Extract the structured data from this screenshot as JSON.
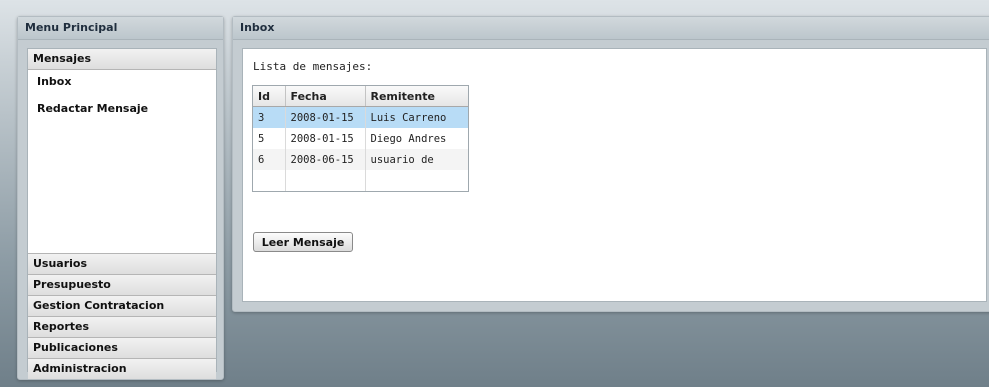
{
  "menu": {
    "title": "Menu Principal",
    "mensajes": {
      "label": "Mensajes",
      "links": [
        "Inbox",
        "Redactar Mensaje"
      ]
    },
    "sections": [
      "Usuarios",
      "Presupuesto",
      "Gestion Contratacion",
      "Reportes",
      "Publicaciones",
      "Administracion"
    ]
  },
  "inbox": {
    "title": "Inbox",
    "caption": "Lista de mensajes:",
    "columns": [
      "Id",
      "Fecha",
      "Remitente"
    ],
    "rows": [
      [
        "3",
        "2008-01-15",
        "Luis Carreno"
      ],
      [
        "5",
        "2008-01-15",
        "Diego Andres"
      ],
      [
        "6",
        "2008-06-15",
        "usuario de"
      ],
      [
        "",
        "",
        ""
      ]
    ],
    "selected_row": 0,
    "button_label": "Leer Mensaje"
  },
  "colors": {
    "selection": "#b8dcf6",
    "panel": "#c4ccd1"
  }
}
